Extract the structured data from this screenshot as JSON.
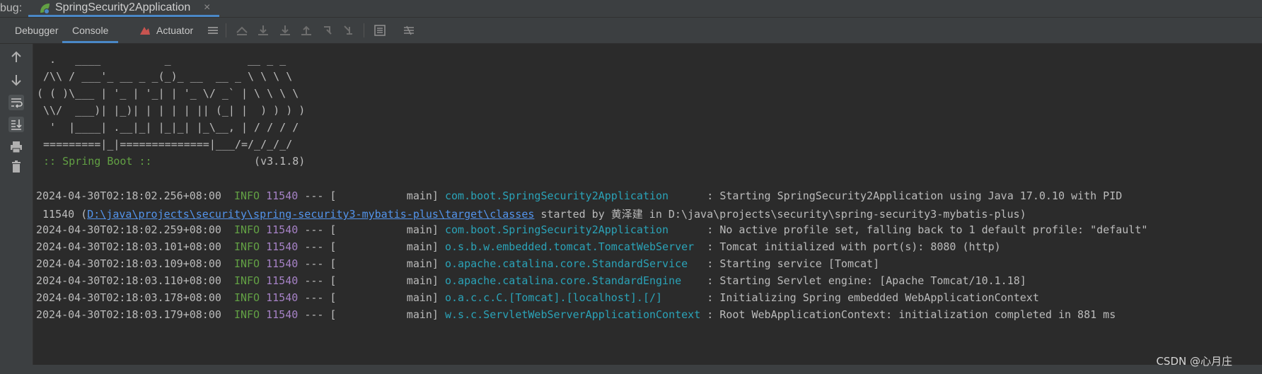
{
  "title_bar": {
    "label": "bug:",
    "run_tab": "SpringSecurity2Application",
    "close_glyph": "×"
  },
  "toolbar": {
    "tabs": [
      "Debugger",
      "Console",
      "Actuator"
    ]
  },
  "banner": [
    "  .   ____          _            __ _ _",
    " /\\\\ / ___'_ __ _ _(_)_ __  __ _ \\ \\ \\ \\",
    "( ( )\\___ | '_ | '_| | '_ \\/ _` | \\ \\ \\ \\",
    " \\\\/  ___)| |_)| | | | | || (_| |  ) ) ) )",
    "  '  |____| .__|_| |_|_| |_\\__, | / / / /",
    " =========|_|==============|___/=/_/_/_/"
  ],
  "spring_boot": {
    "label": " :: Spring Boot :: ",
    "version": "               (v3.1.8)"
  },
  "log": [
    {
      "ts": "2024-04-30T02:18:02.256+08:00",
      "level": "INFO",
      "pid": "11540",
      "sep": "--- [",
      "thread": "           main]",
      "logger": "com.boot.SpringSecurity2Application     ",
      "msg": " : Starting SpringSecurity2Application using Java 17.0.10 with PID"
    },
    {
      "ts": "2024-04-30T02:18:02.259+08:00",
      "level": "INFO",
      "pid": "11540",
      "sep": "--- [",
      "thread": "           main]",
      "logger": "com.boot.SpringSecurity2Application     ",
      "msg": " : No active profile set, falling back to 1 default profile: \"default\""
    },
    {
      "ts": "2024-04-30T02:18:03.101+08:00",
      "level": "INFO",
      "pid": "11540",
      "sep": "--- [",
      "thread": "           main]",
      "logger": "o.s.b.w.embedded.tomcat.TomcatWebServer ",
      "msg": " : Tomcat initialized with port(s): 8080 (http)"
    },
    {
      "ts": "2024-04-30T02:18:03.109+08:00",
      "level": "INFO",
      "pid": "11540",
      "sep": "--- [",
      "thread": "           main]",
      "logger": "o.apache.catalina.core.StandardService  ",
      "msg": " : Starting service [Tomcat]"
    },
    {
      "ts": "2024-04-30T02:18:03.110+08:00",
      "level": "INFO",
      "pid": "11540",
      "sep": "--- [",
      "thread": "           main]",
      "logger": "o.apache.catalina.core.StandardEngine   ",
      "msg": " : Starting Servlet engine: [Apache Tomcat/10.1.18]"
    },
    {
      "ts": "2024-04-30T02:18:03.178+08:00",
      "level": "INFO",
      "pid": "11540",
      "sep": "--- [",
      "thread": "           main]",
      "logger": "o.a.c.c.C.[Tomcat].[localhost].[/]      ",
      "msg": " : Initializing Spring embedded WebApplicationContext"
    },
    {
      "ts": "2024-04-30T02:18:03.179+08:00",
      "level": "INFO",
      "pid": "11540",
      "sep": "--- [",
      "thread": "           main]",
      "logger": "w.s.c.ServletWebServerApplicationContext",
      "msg": " : Root WebApplicationContext: initialization completed in 881 ms"
    }
  ],
  "wrap": {
    "pid": " 11540 (",
    "path": "D:\\java\\projects\\security\\spring-security3-mybatis-plus\\target\\classes",
    "rest": " started by 黄泽建 in D:\\java\\projects\\security\\spring-security3-mybatis-plus)"
  },
  "watermark": "CSDN @心月庄",
  "colors": {
    "accent": "#4a88c7",
    "info": "#62a044",
    "logger": "#2aa3b8",
    "pid": "#a682c6",
    "link": "#5394ec"
  },
  "icons": [
    "spring-leaf-icon",
    "actuator-icon",
    "up-arrow-icon",
    "down-arrow-icon",
    "soft-wrap-icon",
    "scroll-to-end-icon",
    "print-icon",
    "trash-icon"
  ]
}
